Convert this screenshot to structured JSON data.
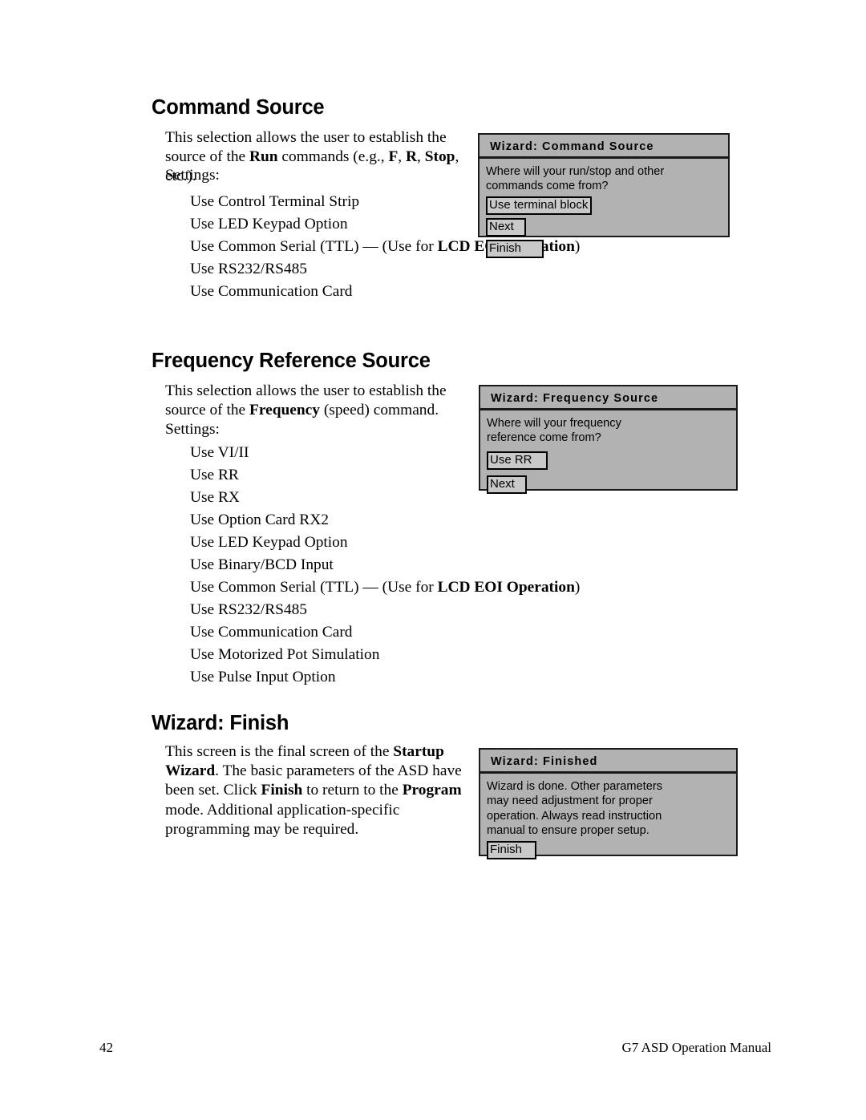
{
  "page": {
    "number": "42",
    "manual_title": "G7 ASD Operation Manual"
  },
  "sections": [
    {
      "heading": "Command Source",
      "paragraph_html": "This selection allows the user to establish the source of the <b>Run</b> commands (e.g., <b>F</b>, <b>R</b>, <b>Stop</b>, etc.).",
      "settings_label": "Settings:",
      "settings": [
        "Use Control Terminal Strip",
        "Use LED Keypad Option",
        "Use Common Serial (TTL) — (Use for LCD EOI Operation)",
        "Use RS232/RS485",
        "Use Communication Card"
      ],
      "settings_html": [
        "Use Control Terminal Strip",
        "Use LED Keypad Option",
        "Use Common Serial (TTL) — (Use for <b>LCD EOI Operation</b>)",
        "Use RS232/RS485",
        "Use Communication Card"
      ]
    },
    {
      "heading": "Frequency Reference Source",
      "paragraph_html": "This selection allows the user to establish the source of the <b>Frequency</b> (speed) command.",
      "settings_label": "Settings:",
      "settings": [
        "Use VI/II",
        "Use RR",
        "Use RX",
        "Use Option Card RX2",
        "Use LED Keypad Option",
        "Use Binary/BCD Input",
        "Use Common Serial (TTL) — (Use for LCD EOI Operation)",
        "Use RS232/RS485",
        "Use Communication Card",
        "Use Motorized Pot Simulation",
        "Use Pulse Input Option"
      ],
      "settings_html": [
        "Use VI/II",
        "Use RR",
        "Use RX",
        "Use Option Card RX2",
        "Use LED Keypad Option",
        "Use Binary/BCD Input",
        "Use Common Serial (TTL) — (Use for <b>LCD EOI Operation</b>)",
        "Use RS232/RS485",
        "Use Communication Card",
        "Use Motorized Pot Simulation",
        "Use Pulse Input Option"
      ]
    },
    {
      "heading": "Wizard: Finish",
      "paragraph_html": "This screen is the final screen of the <b>Startup Wizard</b>. The basic parameters of the ASD have been set. Click <b>Finish</b> to return to the <b>Program</b> mode. Additional application-specific programming may be required."
    }
  ],
  "dialogs": [
    {
      "title": "Wizard: Command Source",
      "message": "Where will your run/stop and other\ncommands come from?",
      "buttons": [
        "Use terminal block",
        "Next",
        "Finish"
      ]
    },
    {
      "title": "Wizard: Frequency Source",
      "message": "Where will your frequency\nreference come from?",
      "buttons": [
        "Use RR",
        "Next"
      ]
    },
    {
      "title": "Wizard: Finished",
      "message": "Wizard is done. Other parameters\nmay need adjustment for proper\noperation. Always read instruction\nmanual to ensure proper setup.",
      "buttons": [
        "Finish"
      ]
    }
  ],
  "colors": {
    "dialog_background": "#b2b2b2",
    "button_fill": "#c9c9c9",
    "border": "#1a1a1a",
    "text": "#000000"
  }
}
